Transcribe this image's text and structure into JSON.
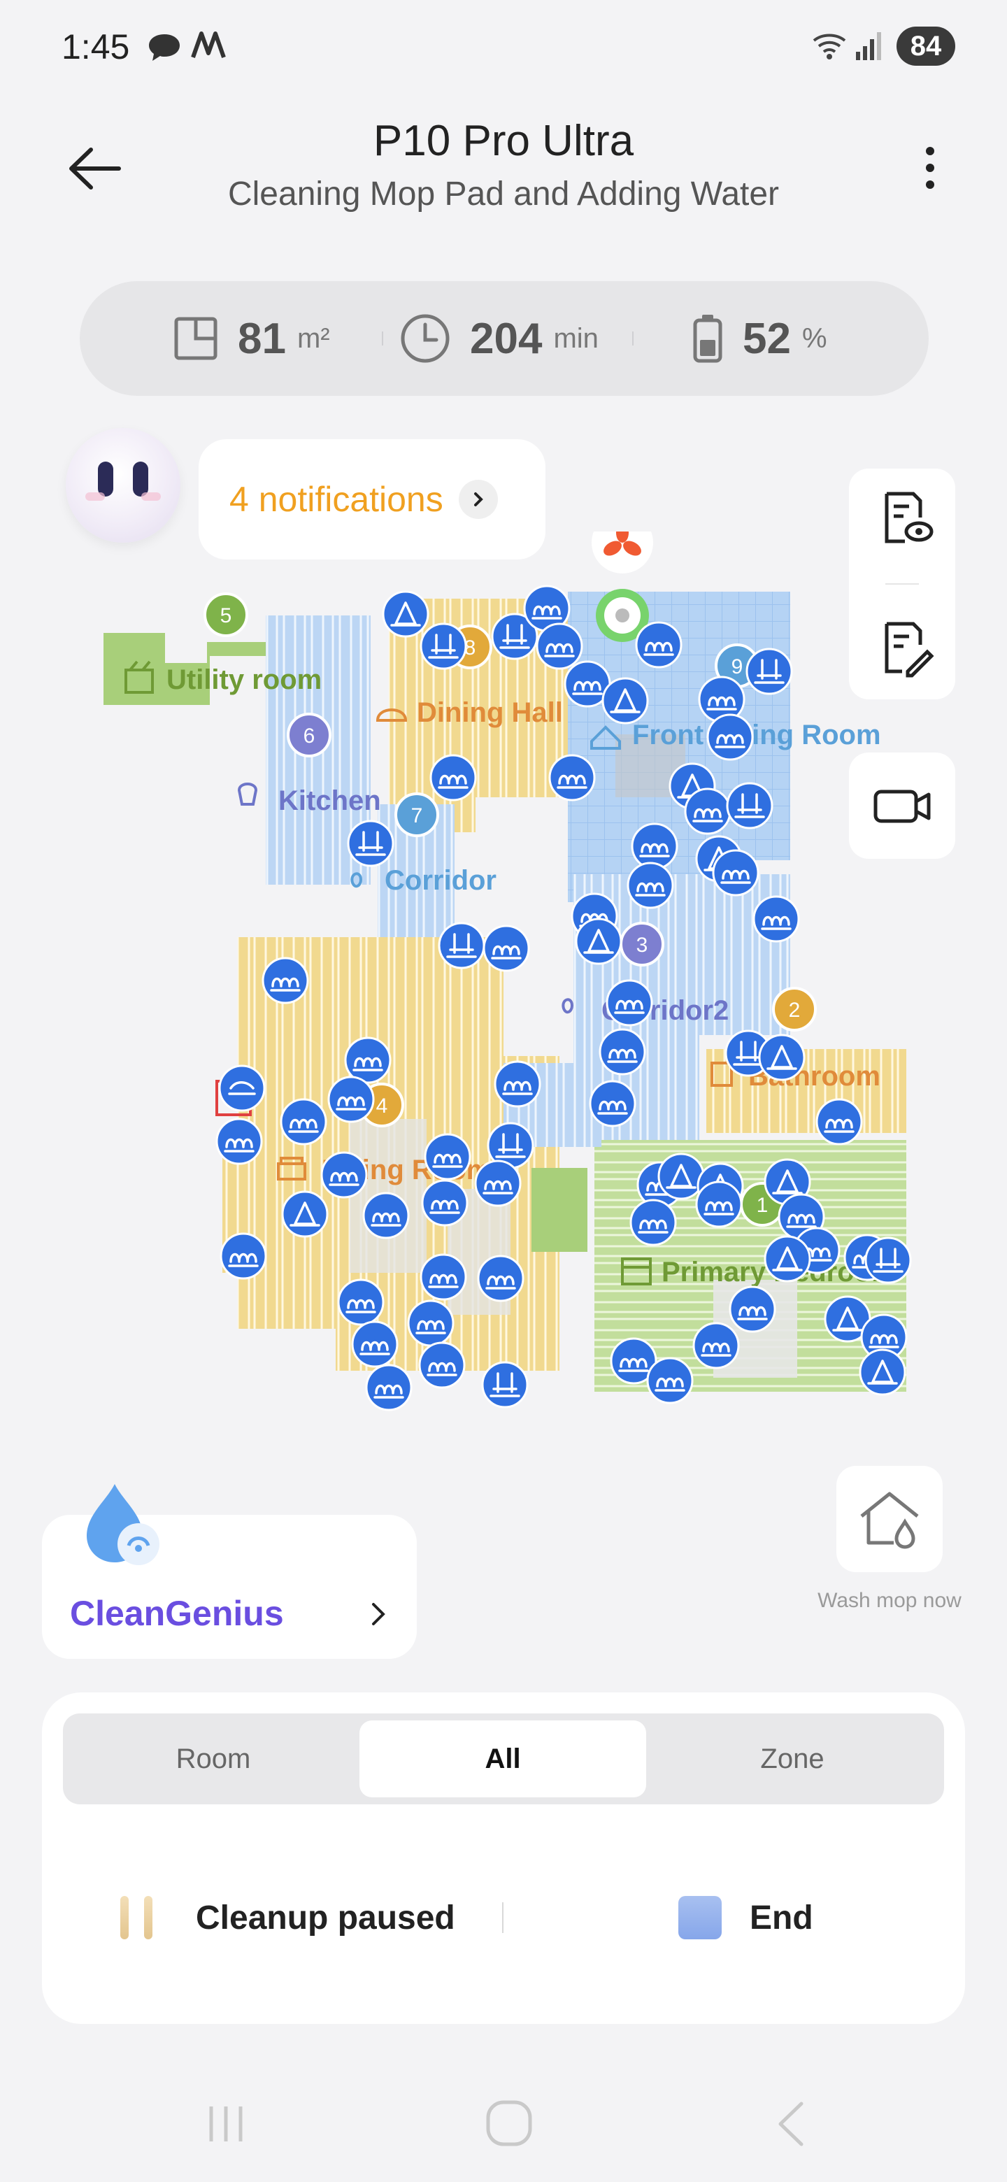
{
  "status_bar": {
    "time": "1:45",
    "battery": "84",
    "icons": [
      "chat-bubble-icon",
      "a-icon",
      "wifi-6-icon",
      "signal-icon"
    ]
  },
  "header": {
    "title": "P10 Pro Ultra",
    "subtitle": "Cleaning Mop Pad and Adding Water",
    "icons": [
      "back-arrow-icon",
      "more-vert-icon"
    ]
  },
  "stats": {
    "area_value": "81",
    "area_unit": "m²",
    "time_value": "204",
    "time_unit": "min",
    "battery_value": "52",
    "battery_unit": "%"
  },
  "notifications": {
    "label": "4 notifications"
  },
  "map": {
    "rooms": [
      {
        "id": "5",
        "name": "Utility room",
        "color": "#6f9a35"
      },
      {
        "id": "6",
        "name": "Kitchen",
        "color": "#6d75c8"
      },
      {
        "id": "8",
        "name": "Dining Hall",
        "color": "#e08b3a"
      },
      {
        "id": "9",
        "name": "Front Living Room",
        "color": "#5aa0d8"
      },
      {
        "id": "7",
        "name": "Corridor",
        "color": "#5aa0d8"
      },
      {
        "id": "3",
        "name": "Corridor2",
        "color": "#6d75c8"
      },
      {
        "id": "2",
        "name": "Bathroom",
        "color": "#e08b3a"
      },
      {
        "id": "4",
        "name": "Living Room",
        "color": "#e08b3a"
      },
      {
        "id": "1",
        "name": "Primary Bedroom",
        "color": "#6f9a35"
      }
    ]
  },
  "clean_genius": {
    "label": "CleanGenius"
  },
  "wash_mop": {
    "label": "Wash mop now"
  },
  "modes": {
    "room": "Room",
    "all": "All",
    "zone": "Zone",
    "selected": "All"
  },
  "controls": {
    "pause_label": "Cleanup paused",
    "end_label": "End"
  },
  "colors": {
    "accent": "#f0a020",
    "marker_blue": "#2f6fe0",
    "genius": "#6a4ee0"
  }
}
